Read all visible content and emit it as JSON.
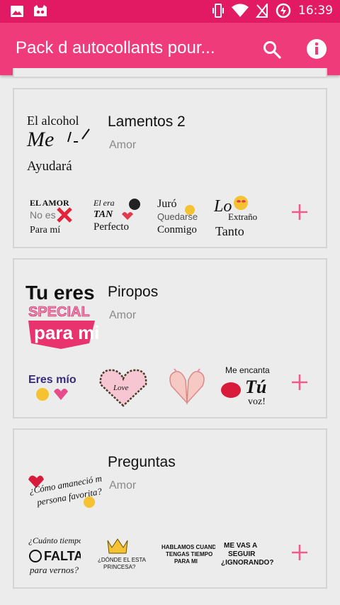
{
  "status_bar": {
    "time": "16:39",
    "icons": [
      "image-icon",
      "cat-icon",
      "vibrate-icon",
      "wifi-icon",
      "no-sim-icon",
      "battery-saver-icon"
    ]
  },
  "app_bar": {
    "title": "Pack d autocollants pour...",
    "actions": [
      "search-icon",
      "info-icon"
    ]
  },
  "colors": {
    "status_bar": "#e21a63",
    "app_bar": "#ef3b7a",
    "accent_plus": "#ec5c8f"
  },
  "packs": [
    {
      "name": "Lamentos 2",
      "category": "Amor",
      "icon_text": [
        "El alcohol",
        "Me",
        "Ayudará"
      ],
      "stickers": [
        {
          "lines": [
            "EL AMOR",
            "No es",
            "Para mí"
          ]
        },
        {
          "lines": [
            "El era",
            "TAN",
            "Perfecto"
          ]
        },
        {
          "lines": [
            "Juró",
            "Quedarse",
            "Conmigo"
          ]
        },
        {
          "lines": [
            "Lo",
            "Extraño",
            "Tanto"
          ]
        }
      ]
    },
    {
      "name": "Piropos",
      "category": "Amor",
      "icon_text": [
        "Tu eres",
        "SPECIAL",
        "para mi"
      ],
      "stickers": [
        {
          "lines": [
            "Eres mío"
          ]
        },
        {
          "lines": [
            "Love"
          ]
        },
        {
          "lines": []
        },
        {
          "lines": [
            "Me encanta",
            "Tú",
            "voz!"
          ]
        }
      ]
    },
    {
      "name": "Preguntas",
      "category": "Amor",
      "icon_text": [
        "¿Cómo amaneció mi",
        "persona favorita?"
      ],
      "stickers": [
        {
          "lines": [
            "¿Cuánto tiempo",
            "FALTA",
            "para vernos?"
          ]
        },
        {
          "lines": [
            "¿DÓNDE EL ESTAS",
            "PRINCESA?"
          ]
        },
        {
          "lines": [
            "HABLAMOS CUANDO",
            "TENGAS TIEMPO",
            "PARA MI"
          ]
        },
        {
          "lines": [
            "ME VAS A",
            "SEGUIR",
            "¿IGNORANDO?"
          ]
        }
      ]
    }
  ]
}
